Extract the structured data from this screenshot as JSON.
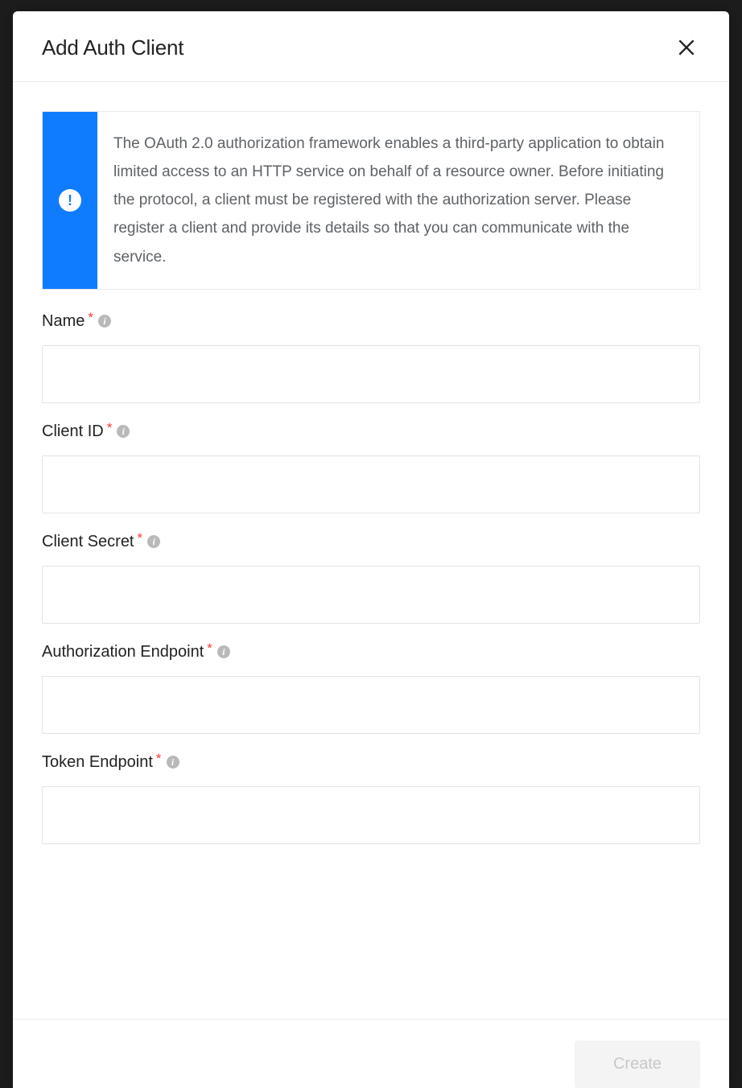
{
  "modal": {
    "title": "Add Auth Client",
    "info_text": "The OAuth 2.0 authorization framework enables a third-party application to obtain limited access to an HTTP service on behalf of a resource owner. Before initiating the protocol, a client must be registered with the authorization server. Please register a client and provide its details so that you can communicate with the service.",
    "fields": {
      "name": {
        "label": "Name",
        "value": "",
        "required": true
      },
      "client_id": {
        "label": "Client ID",
        "value": "",
        "required": true
      },
      "client_secret": {
        "label": "Client Secret",
        "value": "",
        "required": true
      },
      "authorization_endpoint": {
        "label": "Authorization Endpoint",
        "value": "",
        "required": true
      },
      "token_endpoint": {
        "label": "Token Endpoint",
        "value": "",
        "required": true
      }
    },
    "footer": {
      "create_label": "Create"
    },
    "required_marker": "*",
    "info_glyph": "i",
    "alert_glyph": "!"
  },
  "colors": {
    "accent": "#0f7bff",
    "required": "#ff3636"
  }
}
